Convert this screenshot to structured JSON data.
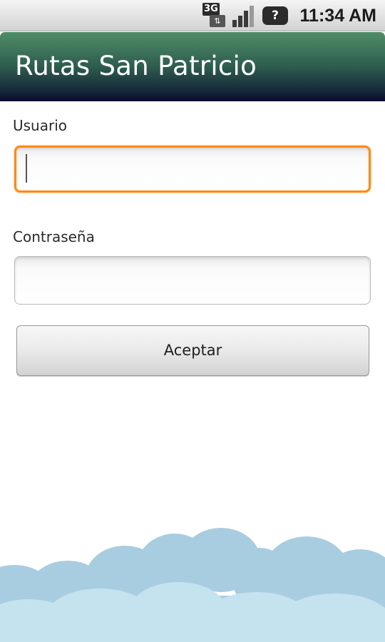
{
  "status_bar": {
    "network_label": "3G",
    "network_arrows": "⇅",
    "signal_icon": "signal-strength-icon",
    "notification_icon": "?",
    "time": "11:34 AM"
  },
  "app": {
    "title": "Rutas San Patricio"
  },
  "form": {
    "username_label": "Usuario",
    "username_value": "",
    "password_label": "Contraseña",
    "password_value": "",
    "accept_label": "Aceptar"
  },
  "colors": {
    "title_bar_top": "#4f8d68",
    "title_bar_bottom": "#080a2c",
    "focus_border": "#ff8a12",
    "cloud_dark": "#a9cde0",
    "cloud_light": "#c5e2ef"
  }
}
